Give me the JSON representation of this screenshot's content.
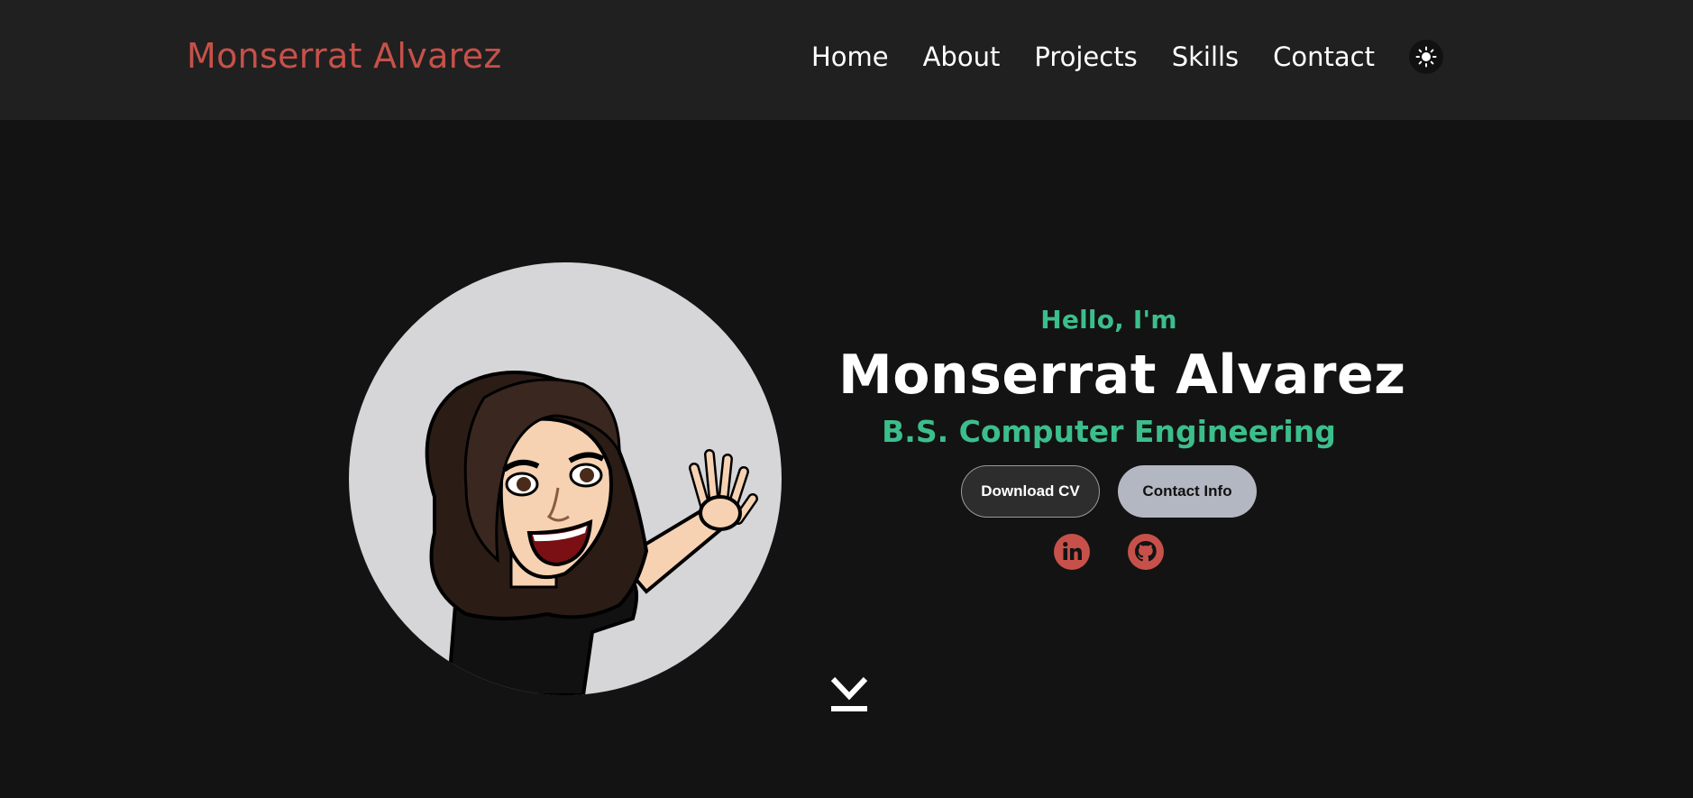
{
  "nav": {
    "brand": "Monserrat Alvarez",
    "links": [
      "Home",
      "About",
      "Projects",
      "Skills",
      "Contact"
    ],
    "theme_icon": "sun-icon"
  },
  "hero": {
    "greeting": "Hello, I'm",
    "name": "Monserrat Alvarez",
    "degree": "B.S. Computer Engineering",
    "buttons": {
      "download_cv": "Download CV",
      "contact_info": "Contact Info"
    },
    "socials": [
      "linkedin-icon",
      "github-icon"
    ],
    "scroll_icon": "scroll-down-icon"
  },
  "colors": {
    "background": "#131313",
    "navbar": "#202020",
    "brand": "#c7514a",
    "accent_green": "#3cbe8c",
    "social_red": "#c7514a"
  }
}
